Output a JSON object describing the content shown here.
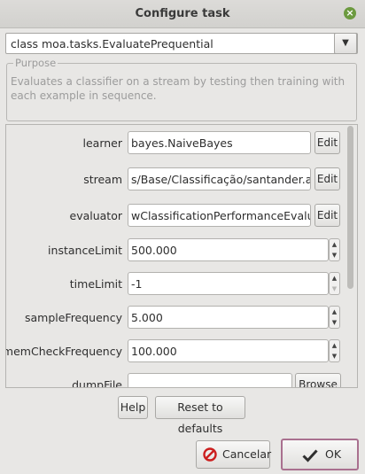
{
  "window": {
    "title": "Configure task"
  },
  "task_combo": {
    "value": "class moa.tasks.EvaluatePrequential"
  },
  "purpose": {
    "legend": "Purpose",
    "text": "Evaluates a classifier on a stream by testing then training with each example in sequence."
  },
  "options": [
    {
      "label": "learner",
      "value": "bayes.NaiveBayes",
      "button": "Edit"
    },
    {
      "label": "stream",
      "value": "s/Base/Classificação/santander.arff",
      "button": "Edit"
    },
    {
      "label": "evaluator",
      "value": "wClassificationPerformanceEvaluator",
      "button": "Edit"
    },
    {
      "label": "instanceLimit",
      "value": "500.000"
    },
    {
      "label": "timeLimit",
      "value": "-1"
    },
    {
      "label": "sampleFrequency",
      "value": "5.000"
    },
    {
      "label": "memCheckFrequency",
      "value": "100.000"
    },
    {
      "label": "dumpFile",
      "value": "",
      "button": "Browse"
    }
  ],
  "buttons": {
    "help": "Help",
    "reset": "Reset to defaults",
    "cancel": "Cancelar",
    "ok": "OK"
  },
  "colors": {
    "ok_border": "#a9708f",
    "cancel_icon": "#cc1f1f",
    "close_icon": "#6c9a3f"
  },
  "icons": {
    "close": "close-icon",
    "cancel": "cancel-icon",
    "ok": "checkmark-icon",
    "dropdown": "chevron-down-icon"
  }
}
